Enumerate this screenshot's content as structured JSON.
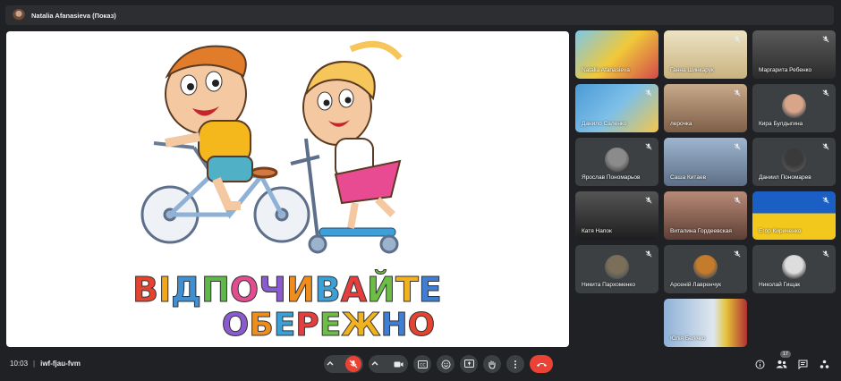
{
  "presenter": {
    "name": "Natalia Afanasieva (Показ)"
  },
  "slide": {
    "line1": "ВІДПОЧИВАЙТЕ",
    "line2": "ОБЕРЕЖНО",
    "letter_colors": [
      "#e5432f",
      "#f2a81d",
      "#3f8fd3",
      "#5fb849",
      "#e24d8f",
      "#8a5bd0",
      "#f08d1c",
      "#3aa0d5",
      "#e53e3e",
      "#6cbe45",
      "#f2b21d",
      "#3f7ed2"
    ]
  },
  "participants": [
    {
      "name": "Natalia Afanasieva",
      "muted": false
    },
    {
      "name": "Ганна Шинкарук",
      "muted": true
    },
    {
      "name": "Маргарита Ребенко",
      "muted": true
    },
    {
      "name": "Данило Саленко",
      "muted": true
    },
    {
      "name": "лерочка",
      "muted": true
    },
    {
      "name": "Кира Булдыгина",
      "muted": true
    },
    {
      "name": "Ярослав Пономарьов",
      "muted": true
    },
    {
      "name": "Саша Китаев",
      "muted": true
    },
    {
      "name": "Даниил Пономарев",
      "muted": true
    },
    {
      "name": "Катя Напок",
      "muted": true
    },
    {
      "name": "Виталина Гордеевская",
      "muted": true
    },
    {
      "name": "Егор Кириченко",
      "muted": true
    },
    {
      "name": "Никита Пархоменко",
      "muted": true
    },
    {
      "name": "Арсеній Лавренчук",
      "muted": true
    },
    {
      "name": "Николай Гищак",
      "muted": true
    },
    {
      "name": "Юлія Белічко",
      "muted": false
    }
  ],
  "meeting": {
    "time": "10:03",
    "separator": "|",
    "code": "iwf-fjau-fvm"
  },
  "toolbar": {
    "participants_count": "17"
  },
  "icons": {
    "mic": "mic-off-icon",
    "camera": "camera-icon",
    "captions": "captions-icon",
    "emoji": "emoji-icon",
    "present": "present-icon",
    "hand": "raise-hand-icon",
    "more": "more-vert-icon",
    "end": "call-end-icon",
    "info": "info-icon",
    "people": "people-icon",
    "chat": "chat-icon",
    "activities": "activities-icon"
  },
  "colors": {
    "background": "#202124",
    "tile": "#3c4043",
    "danger": "#ea4335"
  }
}
